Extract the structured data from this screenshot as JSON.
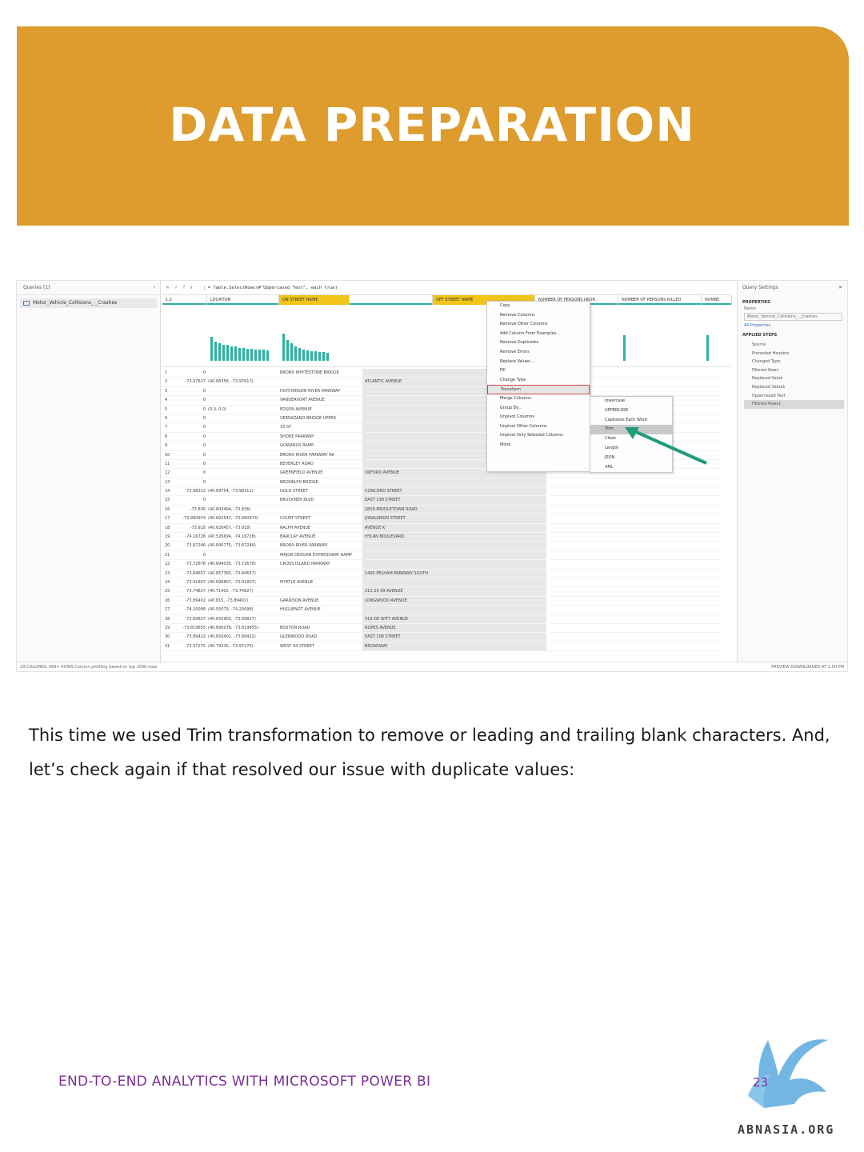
{
  "banner": {
    "title": "DATA PREPARATION"
  },
  "screenshot": {
    "queries_label": "Queries [1]",
    "query_name": "Motor_Vehicle_Collisions_-_Crashes",
    "formula": "= Table.SelectRows(#\"Uppercased Text\", each true)",
    "columns": [
      "LOCATION",
      "ON STREET NAME",
      "OFF STREET NAME",
      "NUMBER OF PERSONS INJUR...",
      "NUMBER OF PERSONS KILLED",
      "NUMBE"
    ],
    "context_menu": [
      "Copy",
      "Remove Columns",
      "Remove Other Columns",
      "Add Column From Examples...",
      "Remove Duplicates",
      "Remove Errors",
      "Replace Values...",
      "Fill",
      "Change Type",
      "Transform",
      "Merge Columns",
      "Group By...",
      "Unpivot Columns",
      "Unpivot Other Columns",
      "Unpivot Only Selected Columns",
      "Move"
    ],
    "submenu": [
      "lowercase",
      "UPPERCASE",
      "Capitalize Each Word",
      "Trim",
      "Clean",
      "Length",
      "JSON",
      "XML"
    ],
    "rows": [
      [
        "1",
        "0",
        "",
        "BRONX WHITESTONE BRIDGE",
        ""
      ],
      [
        "2",
        "-73.97617",
        "(40.68358, -73.97617)",
        "",
        "ATLANTIC AVENUE"
      ],
      [
        "3",
        "0",
        "",
        "HUTCHINSON RIVER PARKWAY",
        ""
      ],
      [
        "4",
        "0",
        "",
        "VANDERVORT AVENUE",
        ""
      ],
      [
        "5",
        "0",
        "(0.0, 0.0)",
        "EDSON AVENUE",
        ""
      ],
      [
        "6",
        "0",
        "",
        "VERRAZANO BRIDGE UPPER",
        ""
      ],
      [
        "7",
        "0",
        "",
        "33 ST",
        ""
      ],
      [
        "8",
        "0",
        "",
        "SHORE PARKWAY",
        ""
      ],
      [
        "9",
        "0",
        "",
        "GOWANUS RAMP",
        ""
      ],
      [
        "10",
        "0",
        "",
        "BRONX RIVER PARKWAY RA",
        ""
      ],
      [
        "11",
        "0",
        "",
        "BEVERLEY ROAD",
        ""
      ],
      [
        "12",
        "0",
        "",
        "GREENFIELD AVENUE",
        "OXFORD AVENUE"
      ],
      [
        "13",
        "0",
        "",
        "BROOKLYN BRIDGE",
        ""
      ],
      [
        "14",
        "-73.98312",
        "(40.69754, -73.98312)",
        "GOLD STREET",
        "CONCORD STREET"
      ],
      [
        "15",
        "0",
        "",
        "BRUCKNER BLVD",
        "EAST 138 STREET"
      ],
      [
        "16",
        "-73.836",
        "(40.843494, -73.836)",
        "",
        "2819 MIDDLETOWN ROAD"
      ],
      [
        "17",
        "-73.990974",
        "(40.692547, -73.990974)",
        "COURT STREET",
        "JORALEMON STREET"
      ],
      [
        "18",
        "-73.918",
        "(40.626457, -73.918)",
        "RALPH AVENUE",
        "AVENUE K"
      ],
      [
        "19",
        "-74.16728",
        "(40.526694, -74.16728)",
        "BARCLAY AVENUE",
        "HYLAN BOULEVARD"
      ],
      [
        "20",
        "-73.87246",
        "(40.840775, -73.87246)",
        "BRONX RIVER PARKWAY",
        ""
      ],
      [
        "21",
        "0",
        "",
        "MAJOR DEEGAN EXPRESSWAY RAMP",
        ""
      ],
      [
        "22",
        "-73.72678",
        "(40.694035, -73.72678)",
        "CROSS ISLAND PARKWAY",
        ""
      ],
      [
        "23",
        "-73.84657",
        "(40.857365, -73.84657)",
        "",
        "1400 PELHAM PARKWAY SOUTH"
      ],
      [
        "24",
        "-73.91807",
        "(40.698807, -73.91807)",
        "MYRTLE AVENUE",
        ""
      ],
      [
        "25",
        "-73.74827",
        "(40.71402, -73.74827)",
        "",
        "211-20 99 AVENUE"
      ],
      [
        "26",
        "-73.89402",
        "(40.815, -73.89402)",
        "GARRISON AVENUE",
        "LONGWOOD AVENUE"
      ],
      [
        "27",
        "-74.20098",
        "(40.55079, -74.20098)",
        "HUGUENOT AVENUE",
        ""
      ],
      [
        "28",
        "-73.89827",
        "(40.655905, -73.89827)",
        "",
        "319 DE WITT AVENUE"
      ],
      [
        "29",
        "-73.819855",
        "(40.690076, -73.819855)",
        "BOSTON ROAD",
        "ROPES AVENUE"
      ],
      [
        "30",
        "-73.89422",
        "(40.650402, -73.89422)",
        "GLENWOOD ROAD",
        "EAST 108 STREET"
      ],
      [
        "31",
        "-73.97275",
        "(40.79335, -73.97275)",
        "WEST 94 STREET",
        "BROADWAY"
      ]
    ],
    "settings": {
      "title": "Query Settings",
      "properties": "PROPERTIES",
      "name_label": "Name",
      "name_value": "Motor_Vehicle_Collisions_-_Crashes",
      "all_properties": "All Properties",
      "applied_steps": "APPLIED STEPS",
      "steps": [
        "Source",
        "Promoted Headers",
        "Changed Type",
        "Filtered Rows",
        "Replaced Value",
        "Replaced Value1",
        "Uppercased Text",
        "Filtered Rows1"
      ]
    },
    "status_left": "29 COLUMNS, 999+ ROWS   Column profiling based on top 1000 rows",
    "status_right": "PREVIEW DOWNLOADED AT 1:50 PM"
  },
  "body": {
    "paragraph": "This time we used Trim transformation to remove or leading and trailing blank characters. And, let’s check again if that resolved our issue with duplicate values:"
  },
  "footer": {
    "title": "END-TO-END ANALYTICS WITH MICROSOFT POWER BI",
    "page": "23",
    "logo_text": "ABNASIA.ORG"
  }
}
